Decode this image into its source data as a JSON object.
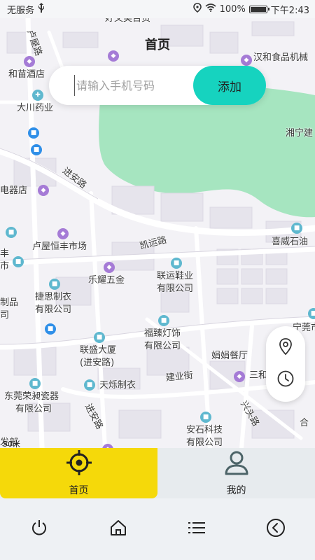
{
  "status_bar": {
    "carrier": "无服务",
    "usb_icon": "usb-icon",
    "battery": "100%",
    "time": "下午2:43"
  },
  "page": {
    "title": "首页"
  },
  "search": {
    "placeholder": "请输入手机号码",
    "value": "",
    "add_label": "添加"
  },
  "map": {
    "scale": "50米",
    "labels": [
      "好又美百货",
      "卢屋路",
      "和苗酒店",
      "汉和食品机械",
      "大川药业",
      "湘宁建",
      "进安路",
      "电器店",
      "喜威石油",
      "卢屋恒丰市场",
      "凯运路",
      "乐耀五金",
      "联运鞋业",
      "有限公司",
      "捷思制衣",
      "有限公司",
      "制品",
      "司",
      "福臻灯饰",
      "有限公司",
      "娟娟餐厅",
      "联盛大厦",
      "(进安路)",
      "天烁制衣",
      "建业街",
      "东莞荣昶瓷器",
      "有限公司",
      "进安路",
      "安石科技",
      "有限公司",
      "兴头路",
      "合",
      "发部",
      "三和",
      "丰",
      "市",
      "宁莞市"
    ]
  },
  "tabs": [
    {
      "label": "首页",
      "icon": "locate-crosshair-icon",
      "active": true
    },
    {
      "label": "我的",
      "icon": "user-icon",
      "active": false
    }
  ],
  "nav": [
    "power-icon",
    "home-icon",
    "menu-icon",
    "back-icon"
  ],
  "colors": {
    "accent": "#16d3bf",
    "tab_active": "#f5d90a",
    "park": "#a6e5c0"
  }
}
